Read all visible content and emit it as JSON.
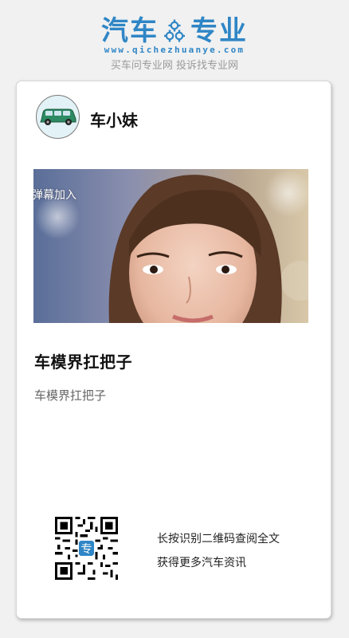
{
  "brand": {
    "name_left": "汽车",
    "name_right": "专业",
    "url": "www.qichezhuanye.com",
    "slogan": "买车问专业网 投诉找专业网",
    "color": "#2f86c6"
  },
  "author": {
    "name": "车小妹",
    "avatar_icon": "car-avatar-icon"
  },
  "article": {
    "hero_overlay_text": "弹幕加入",
    "title": "车模界扛把子",
    "summary": "车模界扛把子"
  },
  "qr": {
    "line1": "长按识别二维码查阅全文",
    "line2": "获得更多汽车资讯",
    "center_badge": "专"
  }
}
